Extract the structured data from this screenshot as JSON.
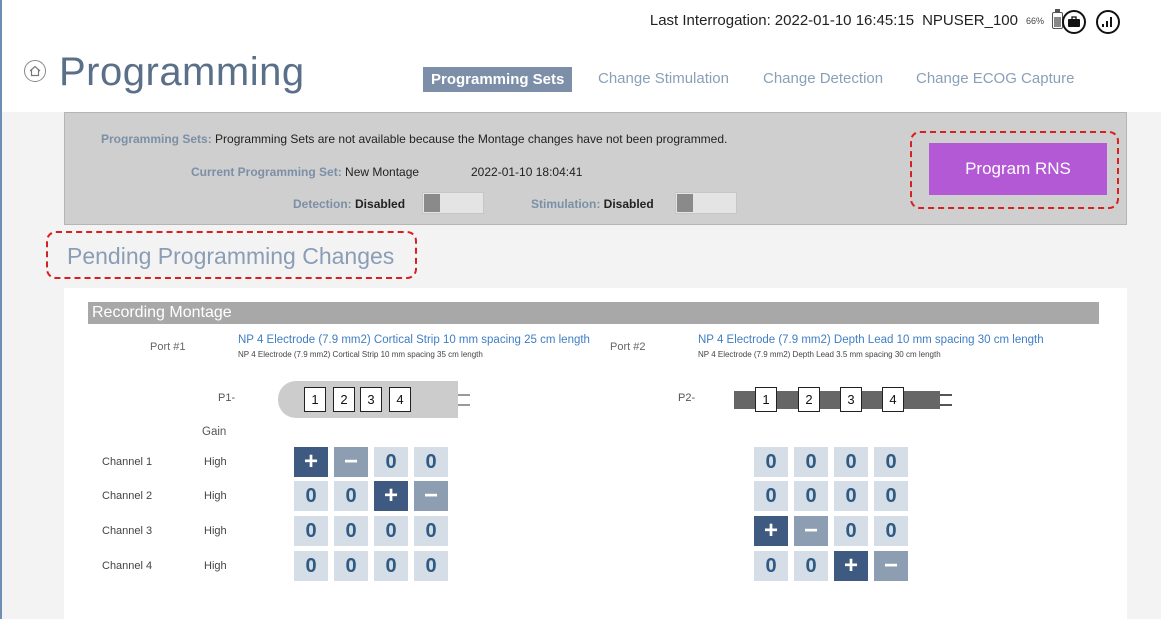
{
  "header": {
    "interrogation_label": "Last Interrogation:",
    "interrogation_value": "2022-01-10 16:45:15",
    "user": "NPUSER_100",
    "battery_pct": "66%",
    "battery_level": 0.66,
    "icons": [
      "briefcase-icon",
      "signal-icon"
    ]
  },
  "page": {
    "title": "Programming",
    "home_icon": "home-icon"
  },
  "tabs": [
    {
      "label": "Programming Sets",
      "active": true
    },
    {
      "label": "Change Stimulation",
      "active": false
    },
    {
      "label": "Change Detection",
      "active": false
    },
    {
      "label": "Change ECOG Capture",
      "active": false
    }
  ],
  "panel": {
    "sets_label": "Programming Sets:",
    "sets_message": "Programming Sets are not available because the Montage changes have not been programmed.",
    "current_label": "Current Programming Set:",
    "current_value": "New Montage",
    "current_date": "2022-01-10 18:04:41",
    "detection_label": "Detection:",
    "detection_value": "Disabled",
    "stimulation_label": "Stimulation:",
    "stimulation_value": "Disabled",
    "program_button": "Program RNS"
  },
  "pending_title": "Pending Programming Changes",
  "montage": {
    "title": "Recording Montage",
    "port1": {
      "label": "Port #1",
      "lead": "NP 4 Electrode (7.9 mm2) Cortical Strip 10 mm spacing 25 cm length",
      "lead_sub": "NP 4 Electrode (7.9 mm2) Cortical Strip 10 mm spacing 35 cm length",
      "prefix": "P1-",
      "contacts": [
        "1",
        "2",
        "3",
        "4"
      ]
    },
    "port2": {
      "label": "Port #2",
      "lead": "NP 4 Electrode (7.9 mm2) Depth Lead 10 mm spacing 30 cm length",
      "lead_sub": "NP 4 Electrode (7.9 mm2) Depth Lead 3.5 mm spacing 30 cm length",
      "prefix": "P2-",
      "contacts": [
        "1",
        "2",
        "3",
        "4"
      ]
    },
    "gain_header": "Gain",
    "channels": [
      {
        "name": "Channel 1",
        "gain": "High",
        "p1": [
          "+",
          "−",
          "0",
          "0"
        ],
        "p2": [
          "0",
          "0",
          "0",
          "0"
        ]
      },
      {
        "name": "Channel 2",
        "gain": "High",
        "p1": [
          "0",
          "0",
          "+",
          "−"
        ],
        "p2": [
          "0",
          "0",
          "0",
          "0"
        ]
      },
      {
        "name": "Channel 3",
        "gain": "High",
        "p1": [
          "0",
          "0",
          "0",
          "0"
        ],
        "p2": [
          "+",
          "−",
          "0",
          "0"
        ]
      },
      {
        "name": "Channel 4",
        "gain": "High",
        "p1": [
          "0",
          "0",
          "0",
          "0"
        ],
        "p2": [
          "0",
          "0",
          "+",
          "−"
        ]
      }
    ]
  },
  "colors": {
    "accent_button": "#b359d6",
    "active_tab": "#7d8fa8",
    "plus_cell": "#3f5a80",
    "minus_cell": "#8d9db2",
    "zero_cell": "#d5dde6",
    "highlight": "#d72020"
  }
}
